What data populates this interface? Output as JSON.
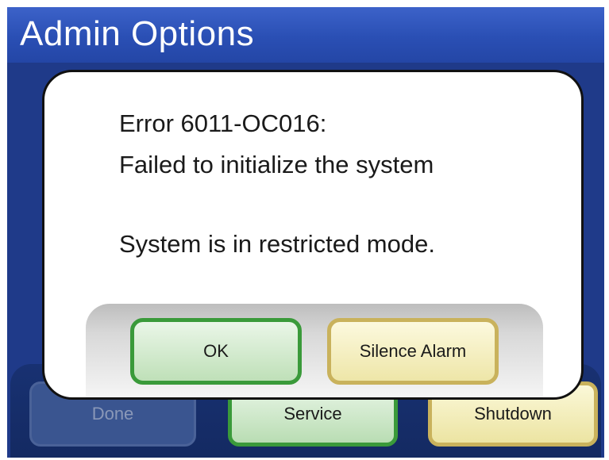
{
  "window": {
    "title": "Admin Options"
  },
  "bottom_bar": {
    "done_label": "Done",
    "service_label": "Service",
    "shutdown_label": "Shutdown"
  },
  "dialog": {
    "lines": [
      "Error 6011-OC016:",
      "Failed to initialize the system",
      "System is in restricted mode."
    ],
    "ok_label": "OK",
    "silence_label": "Silence Alarm"
  },
  "colors": {
    "background_blue": "#1e3a8a",
    "title_bar_blue": "#2a4fb4",
    "ok_green_border": "#3a9a3a",
    "alarm_yellow_border": "#c9b25c"
  }
}
